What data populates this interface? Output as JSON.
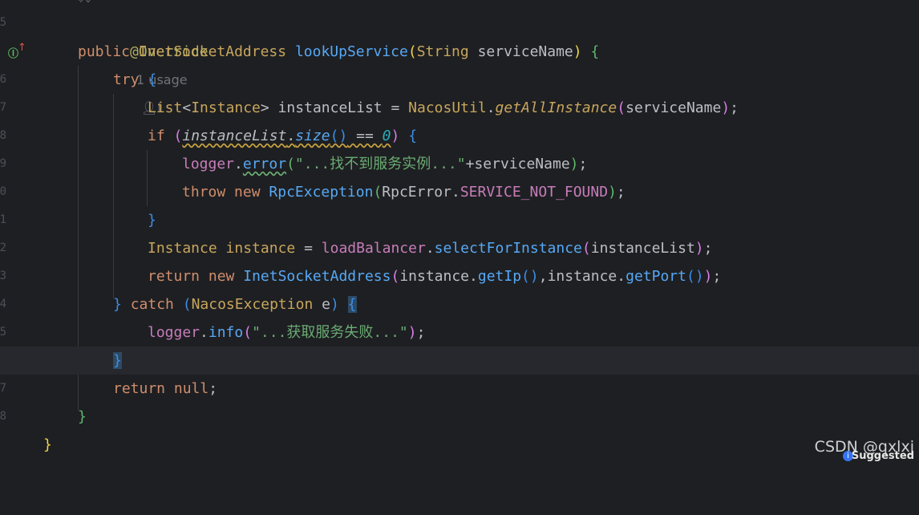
{
  "editor": {
    "hint": {
      "usages": "1 usage",
      "author_icon": "person-icon",
      "author_suffix": "i"
    },
    "line_numbers": [
      "5",
      "6",
      "7",
      "8",
      "9",
      "0",
      "1",
      "2",
      "3",
      "4",
      "5",
      "6",
      "7",
      "8"
    ],
    "lines": {
      "override": "@Override",
      "sig_public": "public",
      "sig_type": "InetSocketAddress",
      "sig_method": "lookUpService",
      "sig_paren_open": "(",
      "sig_param_type": "String",
      "sig_param_name": "serviceName",
      "sig_paren_close": ")",
      "sig_brace": "{",
      "try_kw": "try",
      "try_brace": "{",
      "l3_list": "List",
      "l3_lt": "<",
      "l3_instance": "Instance",
      "l3_gt": ">",
      "l3_var": "instanceList",
      "l3_eq": " = ",
      "l3_util": "NacosUtil",
      "l3_dot": ".",
      "l3_method": "getAllInstance",
      "l3_po": "(",
      "l3_arg": "serviceName",
      "l3_pc": ")",
      "l3_semi": ";",
      "if_kw": "if",
      "if_po": "(",
      "if_var": "instanceList",
      "if_dot": ".",
      "if_size": "size",
      "if_call": "()",
      "if_eq": " == ",
      "if_zero": "0",
      "if_pc": ")",
      "if_brace": "{",
      "err_logger": "logger",
      "err_dot": ".",
      "err_method": "error",
      "err_po": "(",
      "err_str": "\"...找不到服务实例...\"",
      "err_plus": "+serviceName",
      "err_pc": ")",
      "err_semi": ";",
      "throw_kw": "throw",
      "new_kw": "new",
      "throw_cls": "RpcException",
      "throw_po": "(",
      "throw_enum": "RpcError",
      "throw_dot": ".",
      "throw_const": "SERVICE_NOT_FOUND",
      "throw_pc": ")",
      "throw_semi": ";",
      "if_close": "}",
      "inst_type": "Instance",
      "inst_var": "instance",
      "inst_eq": " = ",
      "inst_field": "loadBalancer",
      "inst_dot": ".",
      "inst_method": "selectForInstance",
      "inst_po": "(",
      "inst_arg": "instanceList",
      "inst_pc": ")",
      "inst_semi": ";",
      "ret_kw": "return",
      "ret_new": "new",
      "ret_cls": "InetSocketAddress",
      "ret_po": "(",
      "ret_a1": "instance",
      "ret_d1": ".",
      "ret_m1": "getIp",
      "ret_c1": "()",
      "ret_comma": ",",
      "ret_a2": "instance",
      "ret_d2": ".",
      "ret_m2": "getPort",
      "ret_c2": "()",
      "ret_pc": ")",
      "ret_semi": ";",
      "catch_close": "}",
      "catch_kw": "catch",
      "catch_po": "(",
      "catch_type": "NacosException",
      "catch_var": "e",
      "catch_pc": ")",
      "catch_brace": "{",
      "info_logger": "logger",
      "info_dot": ".",
      "info_method": "info",
      "info_po": "(",
      "info_str": "\"...获取服务失败...\"",
      "info_pc": ")",
      "info_semi": ";",
      "catch_end": "}",
      "retnull_kw": "return",
      "retnull_val": "null",
      "retnull_semi": ";",
      "method_close": "}",
      "class_close": "}"
    }
  },
  "watermark": {
    "text": "CSDN @qxlxj",
    "badge": "Suggested",
    "badge_icon": "info-icon"
  },
  "colors": {
    "background": "#1e1f22",
    "current_line": "#26282e",
    "keyword": "#cf8e6d",
    "method": "#56a8f5",
    "string": "#6aab73",
    "field": "#c77dbb",
    "number": "#2aacb8",
    "annotation": "#b3ae60"
  }
}
